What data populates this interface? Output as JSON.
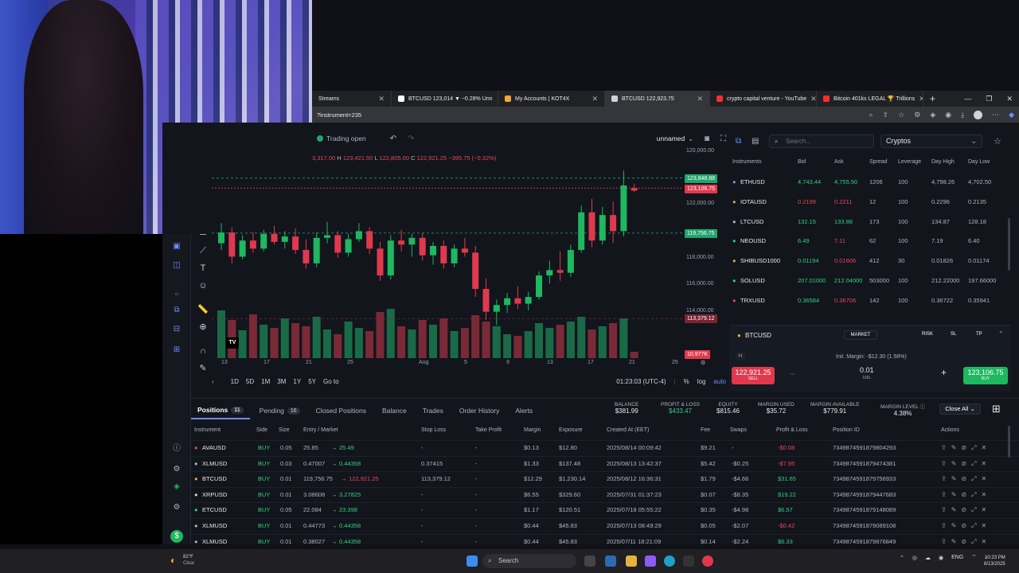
{
  "browser": {
    "tabs": [
      {
        "label": "Streams",
        "color": "#ff4f4f"
      },
      {
        "label": "BTCUSD 123,014 ▼ −0.28% Unn",
        "color": "#ffffff"
      },
      {
        "label": "My Accounts | KOT4X",
        "color": "#f3a53b"
      },
      {
        "label": "BTCUSD 122,923.75",
        "color": "#cfd3dc",
        "active": true
      },
      {
        "label": "crypto capital venture - YouTube",
        "color": "#ff2d2d"
      },
      {
        "label": "Bitcoin 401ks LEGAL 🏆 Trillions",
        "color": "#ff2d2d"
      }
    ],
    "url": "?instrument=235"
  },
  "chart_toolbar": {
    "trading_status": "Trading open",
    "layout_name": "unnamed"
  },
  "ohlc": {
    "o_val": "3,317.00",
    "h_key": "H",
    "h_val": "123,421.50",
    "l_key": "L",
    "l_val": "122,805.00",
    "c_key": "C",
    "c_val": "122,921.25",
    "change": "−395.75 (−0.32%)"
  },
  "price_axis": {
    "labels": [
      "120,000.00",
      "122,000.00",
      "118,000.00",
      "116,000.00",
      "114,000.00"
    ],
    "tags": [
      {
        "text": "123,848.88",
        "color": "#1fa56b"
      },
      {
        "text": "123,106.75",
        "color": "#e0394e"
      },
      {
        "text": "119,756.75",
        "color": "#1fa56b"
      },
      {
        "text": "113,379.12",
        "color": "#7a2430"
      },
      {
        "text": "10.977K",
        "color": "#e0394e"
      }
    ]
  },
  "time_axis": [
    "13",
    "17",
    "21",
    "25",
    "Aug",
    "5",
    "9",
    "13",
    "17",
    "21",
    "25"
  ],
  "range_bar": {
    "ranges": [
      "1D",
      "5D",
      "1M",
      "3M",
      "1Y",
      "5Y"
    ],
    "goto": "Go to",
    "clock": "01:23:03 (UTC-4)",
    "pct": "%",
    "log": "log",
    "auto": "auto"
  },
  "chart_data": {
    "type": "candlestick",
    "title": "",
    "ylim": [
      110000,
      126000
    ],
    "candles": [
      [
        119000,
        120500,
        118500,
        119800
      ],
      [
        119800,
        120200,
        117500,
        118000
      ],
      [
        118000,
        119600,
        117800,
        119200
      ],
      [
        119200,
        119800,
        118300,
        118600
      ],
      [
        118600,
        120000,
        118400,
        119700
      ],
      [
        119700,
        120300,
        118900,
        119100
      ],
      [
        119100,
        119900,
        118600,
        119500
      ],
      [
        119500,
        120100,
        118200,
        118500
      ],
      [
        118500,
        119300,
        117100,
        117500
      ],
      [
        117500,
        119800,
        117200,
        119400
      ],
      [
        119400,
        120600,
        119000,
        119600
      ],
      [
        119600,
        119900,
        117900,
        118300
      ],
      [
        118300,
        119700,
        118000,
        119300
      ],
      [
        119300,
        120500,
        119100,
        119900
      ],
      [
        119900,
        120200,
        118200,
        118600
      ],
      [
        118600,
        119100,
        116200,
        116600
      ],
      [
        116600,
        119600,
        116300,
        119200
      ],
      [
        119200,
        120000,
        118400,
        118900
      ],
      [
        118900,
        119700,
        118000,
        119400
      ],
      [
        119400,
        119800,
        117700,
        118100
      ],
      [
        118100,
        119100,
        117400,
        118800
      ],
      [
        118800,
        119200,
        117100,
        117500
      ],
      [
        117500,
        118900,
        117200,
        118600
      ],
      [
        118600,
        119400,
        118000,
        118300
      ],
      [
        118300,
        118800,
        115000,
        115600
      ],
      [
        115600,
        116400,
        113300,
        113900
      ],
      [
        113900,
        114800,
        112900,
        114400
      ],
      [
        114400,
        115300,
        113800,
        114900
      ],
      [
        114900,
        115800,
        114100,
        114500
      ],
      [
        114500,
        115400,
        114000,
        115000
      ],
      [
        115000,
        116900,
        114800,
        116600
      ],
      [
        116600,
        117700,
        116000,
        117000
      ],
      [
        117000,
        118400,
        116200,
        116800
      ],
      [
        116800,
        118900,
        116500,
        118500
      ],
      [
        118500,
        121800,
        118300,
        121300
      ],
      [
        121300,
        122300,
        118700,
        119200
      ],
      [
        119200,
        121700,
        118900,
        121100
      ],
      [
        121100,
        122100,
        119000,
        119900
      ],
      [
        119900,
        124400,
        119500,
        123300
      ],
      [
        123100,
        123450,
        122800,
        122920
      ]
    ],
    "volume": [
      60,
      48,
      35,
      55,
      42,
      38,
      50,
      44,
      40,
      52,
      36,
      30,
      46,
      38,
      34,
      58,
      62,
      40,
      36,
      48,
      42,
      50,
      34,
      38,
      54,
      46,
      40,
      30,
      28,
      34,
      44,
      38,
      42,
      46,
      52,
      36,
      40,
      44,
      50,
      8
    ]
  },
  "right_panel": {
    "search_placeholder": "Search...",
    "category": "Cryptos",
    "headers": [
      "Instruments",
      "Bid",
      "Ask",
      "Spread",
      "Leverage",
      "Day High",
      "Day Low"
    ],
    "instruments": [
      {
        "name": "ETHUSD",
        "bid": "4,743.44",
        "ask": "4,755.50",
        "spread": "1206",
        "lev": "100",
        "high": "4,798.26",
        "low": "4,702.50",
        "bid_dir": "up",
        "ask_dir": "up",
        "color": "#8a93ff"
      },
      {
        "name": "IOTAUSD",
        "bid": "0.2199",
        "ask": "0.2211",
        "spread": "12",
        "lev": "100",
        "high": "0.2296",
        "low": "0.2135",
        "bid_dir": "down",
        "ask_dir": "down",
        "color": "#f3a53b"
      },
      {
        "name": "LTCUSD",
        "bid": "132.15",
        "ask": "133.88",
        "spread": "173",
        "lev": "100",
        "high": "134.87",
        "low": "128.18",
        "bid_dir": "up",
        "ask_dir": "up",
        "color": "#aab4ff"
      },
      {
        "name": "NEOUSD",
        "bid": "6.49",
        "ask": "7.11",
        "spread": "62",
        "lev": "100",
        "high": "7.19",
        "low": "6.40",
        "bid_dir": "up",
        "ask_dir": "down",
        "color": "#32d17c"
      },
      {
        "name": "SHIBUSD1000",
        "bid": "0.01194",
        "ask": "0.01606",
        "spread": "412",
        "lev": "30",
        "high": "0.01826",
        "low": "0.01174",
        "bid_dir": "up",
        "ask_dir": "down",
        "color": "#f3a53b"
      },
      {
        "name": "SOLUSD",
        "bid": "207.01000",
        "ask": "212.04000",
        "spread": "503000",
        "lev": "100",
        "high": "212.22000",
        "low": "197.66000",
        "bid_dir": "up",
        "ask_dir": "up",
        "color": "#32d17c"
      },
      {
        "name": "TRXUSD",
        "bid": "0.36584",
        "ask": "0.36706",
        "spread": "142",
        "lev": "100",
        "high": "0.36722",
        "low": "0.35941",
        "bid_dir": "up",
        "ask_dir": "down",
        "color": "#f0445a"
      }
    ],
    "order": {
      "symbol": "BTCUSD",
      "market": "MARKET",
      "risk": "RISK",
      "sl": "SL",
      "tp": "TP",
      "h": "H",
      "init_margin": "Init. Margin: -$12.30 (1.58%)",
      "sell_price": "122,921.25",
      "sell_label": "SELL",
      "lots_value": "0.01",
      "lots_label": "lots",
      "buy_price": "123,106.75",
      "buy_label": "BUY"
    }
  },
  "positions": {
    "tabs": [
      {
        "label": "Positions",
        "count": "11",
        "active": true
      },
      {
        "label": "Pending",
        "count": "16"
      },
      {
        "label": "Closed Positions"
      },
      {
        "label": "Balance"
      },
      {
        "label": "Trades"
      },
      {
        "label": "Order History"
      },
      {
        "label": "Alerts"
      }
    ],
    "stats": [
      {
        "label": "BALANCE",
        "value": "$381.99",
        "color": "#e8eaed"
      },
      {
        "label": "PROFIT & LOSS",
        "value": "$433.47",
        "color": "#32d17c"
      },
      {
        "label": "EQUITY",
        "value": "$815.46",
        "color": "#e8eaed"
      },
      {
        "label": "MARGIN USED",
        "value": "$35.72",
        "color": "#e8eaed"
      },
      {
        "label": "MARGIN AVAILABLE",
        "value": "$779.91",
        "color": "#e8eaed"
      },
      {
        "label": "MARGIN LEVEL ⓘ",
        "value": "4.38%",
        "color": "#e8eaed"
      }
    ],
    "close_all": "Close All",
    "headers": [
      "Instrument",
      "Side",
      "Size",
      "Entry / Market",
      "Stop Loss",
      "Take Profit",
      "Margin",
      "Exposure",
      "Created At (EET)",
      "Fee",
      "Swaps",
      "Profit & Loss",
      "Position ID",
      "Actions"
    ],
    "rows": [
      {
        "inst": "AVAUSD",
        "side": "BUY",
        "size": "0.05",
        "entry": "25.85",
        "market": "25.49",
        "mdir": "up",
        "sl": "-",
        "tp": "-",
        "margin": "$0.13",
        "exposure": "$12.80",
        "created": "2025/08/14 00:09:42",
        "fee": "$9.21",
        "swaps": "-",
        "pl": "-$0.08",
        "pldir": "down",
        "id": "7349874591879804293",
        "color": "#f0445a"
      },
      {
        "inst": "XLMUSD",
        "side": "BUY",
        "size": "0.03",
        "entry": "0.47007",
        "market": "0.44358",
        "mdir": "up",
        "sl": "0.37415",
        "tp": "-",
        "margin": "$1.33",
        "exposure": "$137.48",
        "created": "2025/08/13 13:42:37",
        "fee": "$5.42",
        "swaps": "-$0.25",
        "pl": "-$7.95",
        "pldir": "down",
        "id": "7349874591879474381",
        "color": "#aeb4c0"
      },
      {
        "inst": "BTCUSD",
        "side": "BUY",
        "size": "0.01",
        "entry": "119,756.75",
        "market": "122,921.25",
        "mdir": "down",
        "sl": "113,379.12",
        "tp": "-",
        "margin": "$12.29",
        "exposure": "$1,230.14",
        "created": "2025/08/12 16:36:31",
        "fee": "$1.79",
        "swaps": "-$4.66",
        "pl": "$31.65",
        "pldir": "up",
        "id": "7349874591879756933",
        "color": "#f3a53b"
      },
      {
        "inst": "XRPUSD",
        "side": "BUY",
        "size": "0.01",
        "entry": "3.08608",
        "market": "3.27825",
        "mdir": "up",
        "sl": "-",
        "tp": "-",
        "margin": "$6.55",
        "exposure": "$329.60",
        "created": "2025/07/31 01:37:23",
        "fee": "$0.07",
        "swaps": "-$8.35",
        "pl": "$19.22",
        "pldir": "up",
        "id": "7349874591879447683",
        "color": "#cfd3dc"
      },
      {
        "inst": "ETCUSD",
        "side": "BUY",
        "size": "0.05",
        "entry": "22.084",
        "market": "23.398",
        "mdir": "up",
        "sl": "-",
        "tp": "-",
        "margin": "$1.17",
        "exposure": "$120.51",
        "created": "2025/07/18 05:55:22",
        "fee": "$0.35",
        "swaps": "-$4.98",
        "pl": "$6.57",
        "pldir": "up",
        "id": "7349874591879148089",
        "color": "#32d17c"
      },
      {
        "inst": "XLMUSD",
        "side": "BUY",
        "size": "0.01",
        "entry": "0.44773",
        "market": "0.44358",
        "mdir": "up",
        "sl": "-",
        "tp": "-",
        "margin": "$0.44",
        "exposure": "$45.83",
        "created": "2025/07/13 08:49:29",
        "fee": "$0.05",
        "swaps": "-$2.07",
        "pl": "-$0.42",
        "pldir": "down",
        "id": "7349874591879089108",
        "color": "#aeb4c0"
      },
      {
        "inst": "XLMUSD",
        "side": "BUY",
        "size": "0.01",
        "entry": "0.38027",
        "market": "0.44358",
        "mdir": "up",
        "sl": "-",
        "tp": "-",
        "margin": "$0.44",
        "exposure": "$45.83",
        "created": "2025/07/11 18:21:09",
        "fee": "$0.14",
        "swaps": "-$2.24",
        "pl": "$6.33",
        "pldir": "up",
        "id": "7349874591879876849",
        "color": "#aeb4c0"
      }
    ]
  },
  "taskbar": {
    "temp": "82°F",
    "weather": "Clear",
    "search": "Search",
    "lang": "ENG",
    "time": "10:23 PM",
    "date": "8/13/2025"
  }
}
